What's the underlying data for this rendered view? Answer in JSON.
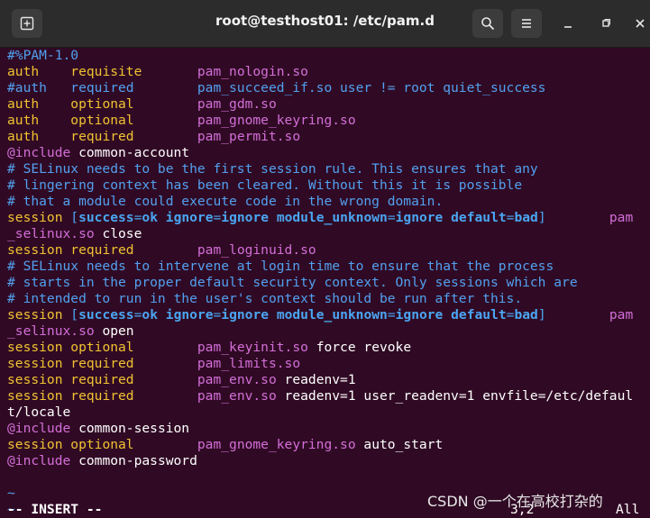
{
  "window": {
    "title": "root@testhost01: /etc/pam.d"
  },
  "icons": {
    "new_tab": "new-tab-icon",
    "search": "search-icon",
    "menu": "hamburger-menu-icon",
    "minimize": "minimize-icon",
    "maximize": "maximize-icon",
    "close": "close-icon"
  },
  "lines": [
    [
      {
        "t": "#%PAM-1.0",
        "c": "c"
      }
    ],
    [
      {
        "t": "auth    ",
        "c": "y"
      },
      {
        "t": "requisite       ",
        "c": "y"
      },
      {
        "t": "pam_nologin.so",
        "c": "m"
      }
    ],
    [
      {
        "t": "#auth   required        pam_succeed_if.so user != root quiet_success",
        "c": "c"
      }
    ],
    [
      {
        "t": "auth    ",
        "c": "y"
      },
      {
        "t": "optional        ",
        "c": "y"
      },
      {
        "t": "pam_gdm.so",
        "c": "m"
      }
    ],
    [
      {
        "t": "auth    ",
        "c": "y"
      },
      {
        "t": "optional        ",
        "c": "y"
      },
      {
        "t": "pam_gnome_keyring.so",
        "c": "m"
      }
    ],
    [
      {
        "t": "auth    ",
        "c": "y"
      },
      {
        "t": "required        ",
        "c": "y"
      },
      {
        "t": "pam_permit.so",
        "c": "m"
      }
    ],
    [
      {
        "t": "@include",
        "c": "m"
      },
      {
        "t": " common-account",
        "c": "w"
      }
    ],
    [
      {
        "t": "# SELinux needs to be the first session rule. This ensures that any",
        "c": "c"
      }
    ],
    [
      {
        "t": "# lingering context has been cleared. Without this it is possible",
        "c": "c"
      }
    ],
    [
      {
        "t": "# that a module could execute code in the wrong domain.",
        "c": "c"
      }
    ],
    [
      {
        "t": "session ",
        "c": "y"
      },
      {
        "t": "[",
        "c": "t"
      },
      {
        "t": "success",
        "c": "b"
      },
      {
        "t": "=",
        "c": "t"
      },
      {
        "t": "ok",
        "c": "b"
      },
      {
        "t": " ",
        "c": "t"
      },
      {
        "t": "ignore",
        "c": "b"
      },
      {
        "t": "=",
        "c": "t"
      },
      {
        "t": "ignore",
        "c": "b"
      },
      {
        "t": " ",
        "c": "t"
      },
      {
        "t": "module_unknown",
        "c": "b"
      },
      {
        "t": "=",
        "c": "t"
      },
      {
        "t": "ignore",
        "c": "b"
      },
      {
        "t": " ",
        "c": "t"
      },
      {
        "t": "default",
        "c": "b"
      },
      {
        "t": "=",
        "c": "t"
      },
      {
        "t": "bad",
        "c": "b"
      },
      {
        "t": "]",
        "c": "t"
      },
      {
        "t": "        pam",
        "c": "m"
      }
    ],
    [
      {
        "t": "_selinux.so",
        "c": "m"
      },
      {
        "t": " close",
        "c": "w"
      }
    ],
    [
      {
        "t": "session ",
        "c": "y"
      },
      {
        "t": "required        ",
        "c": "y"
      },
      {
        "t": "pam_loginuid.so",
        "c": "m"
      }
    ],
    [
      {
        "t": "# SELinux needs to intervene at login time to ensure that the process",
        "c": "c"
      }
    ],
    [
      {
        "t": "# starts in the proper default security context. Only sessions which are",
        "c": "c"
      }
    ],
    [
      {
        "t": "# intended to run in the user's context should be run after this.",
        "c": "c"
      }
    ],
    [
      {
        "t": "session ",
        "c": "y"
      },
      {
        "t": "[",
        "c": "t"
      },
      {
        "t": "success",
        "c": "b"
      },
      {
        "t": "=",
        "c": "t"
      },
      {
        "t": "ok",
        "c": "b"
      },
      {
        "t": " ",
        "c": "t"
      },
      {
        "t": "ignore",
        "c": "b"
      },
      {
        "t": "=",
        "c": "t"
      },
      {
        "t": "ignore",
        "c": "b"
      },
      {
        "t": " ",
        "c": "t"
      },
      {
        "t": "module_unknown",
        "c": "b"
      },
      {
        "t": "=",
        "c": "t"
      },
      {
        "t": "ignore",
        "c": "b"
      },
      {
        "t": " ",
        "c": "t"
      },
      {
        "t": "default",
        "c": "b"
      },
      {
        "t": "=",
        "c": "t"
      },
      {
        "t": "bad",
        "c": "b"
      },
      {
        "t": "]",
        "c": "t"
      },
      {
        "t": "        pam",
        "c": "m"
      }
    ],
    [
      {
        "t": "_selinux.so",
        "c": "m"
      },
      {
        "t": " open",
        "c": "w"
      }
    ],
    [
      {
        "t": "session ",
        "c": "y"
      },
      {
        "t": "optional        ",
        "c": "y"
      },
      {
        "t": "pam_keyinit.so",
        "c": "m"
      },
      {
        "t": " force revoke",
        "c": "w"
      }
    ],
    [
      {
        "t": "session ",
        "c": "y"
      },
      {
        "t": "required        ",
        "c": "y"
      },
      {
        "t": "pam_limits.so",
        "c": "m"
      }
    ],
    [
      {
        "t": "session ",
        "c": "y"
      },
      {
        "t": "required        ",
        "c": "y"
      },
      {
        "t": "pam_env.so",
        "c": "m"
      },
      {
        "t": " readenv=1",
        "c": "w"
      }
    ],
    [
      {
        "t": "session ",
        "c": "y"
      },
      {
        "t": "required        ",
        "c": "y"
      },
      {
        "t": "pam_env.so",
        "c": "m"
      },
      {
        "t": " readenv=1 user_readenv=1 envfile=/etc/defaul",
        "c": "w"
      }
    ],
    [
      {
        "t": "t/locale",
        "c": "w"
      }
    ],
    [
      {
        "t": "@include",
        "c": "m"
      },
      {
        "t": " common-session",
        "c": "w"
      }
    ],
    [
      {
        "t": "session ",
        "c": "y"
      },
      {
        "t": "optional        ",
        "c": "y"
      },
      {
        "t": "pam_gnome_keyring.so",
        "c": "m"
      },
      {
        "t": " auto_start",
        "c": "w"
      }
    ],
    [
      {
        "t": "@include",
        "c": "m"
      },
      {
        "t": " common-password",
        "c": "w"
      }
    ],
    [],
    [
      {
        "t": "~",
        "c": "c"
      }
    ],
    [
      {
        "t": "~",
        "c": "c"
      }
    ]
  ],
  "status": {
    "mode": "-- INSERT --",
    "position": "3,2",
    "scroll": "All"
  },
  "watermark": "CSDN @一个在高校打杂的"
}
